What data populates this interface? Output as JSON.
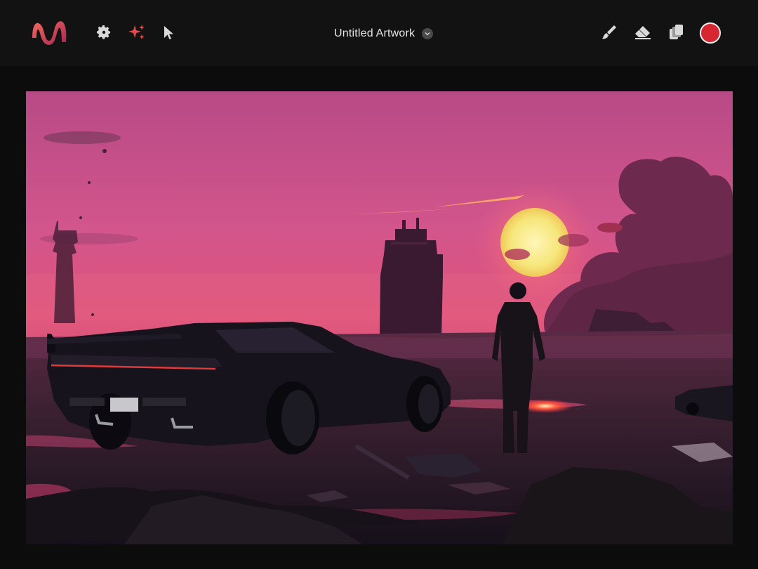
{
  "app": {
    "logo_icon": "brand-logo-icon",
    "document_title": "Untitled Artwork"
  },
  "toolbar_left": [
    {
      "name": "settings",
      "icon": "gear-icon"
    },
    {
      "name": "ai-magic",
      "icon": "sparkle-icon"
    },
    {
      "name": "select",
      "icon": "cursor-arrow-icon"
    }
  ],
  "toolbar_right": [
    {
      "name": "brush",
      "icon": "brush-icon"
    },
    {
      "name": "eraser",
      "icon": "eraser-icon"
    },
    {
      "name": "layers",
      "icon": "layers-icon"
    },
    {
      "name": "color",
      "icon": "color-swatch"
    }
  ],
  "colors": {
    "topbar": "#121212",
    "background": "#0c0c0c",
    "accent_red": "#d6262f",
    "logo_gradient": [
      "#f05a5a",
      "#b3264f"
    ]
  },
  "artwork": {
    "description_elements": [
      "sunset",
      "sports-car",
      "standing-figure",
      "ruined-towers",
      "smoke-cloud",
      "rubble"
    ]
  }
}
